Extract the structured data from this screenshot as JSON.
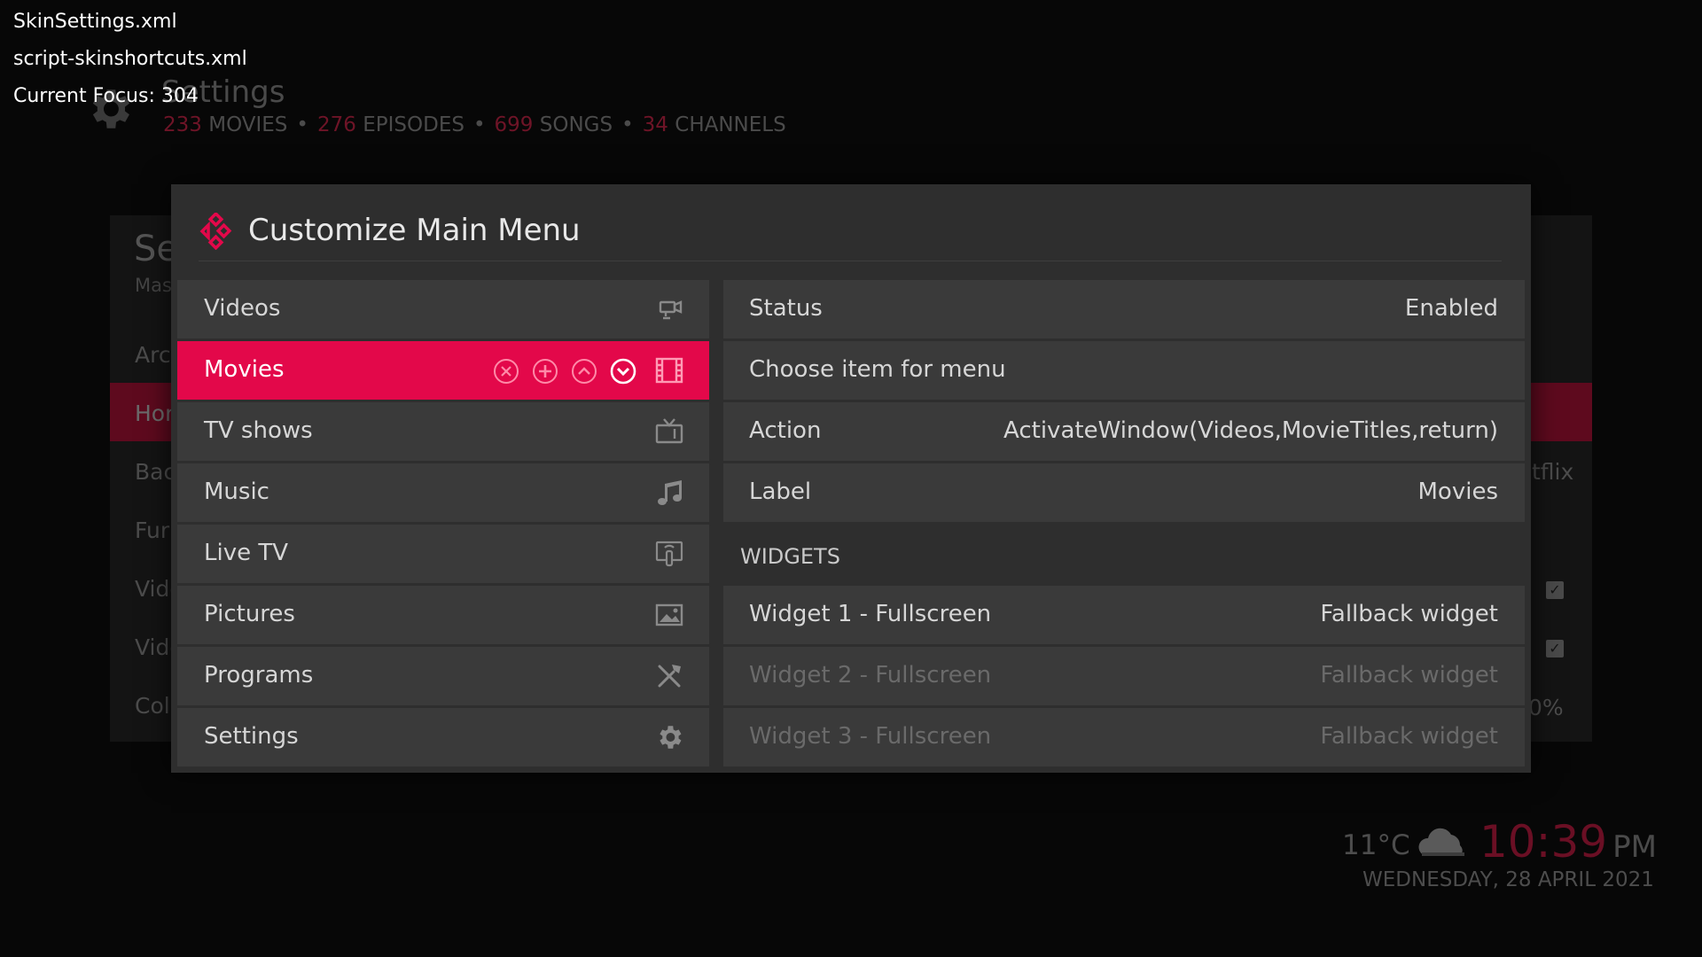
{
  "debug": {
    "line1": "SkinSettings.xml",
    "line2": "script-skinshortcuts.xml",
    "line3": "Current Focus: 304"
  },
  "background": {
    "title": "Settings",
    "stats": {
      "movies_count": "233",
      "movies_label": "MOVIES",
      "episodes_count": "276",
      "episodes_label": "EPISODES",
      "songs_count": "699",
      "songs_label": "SONGS",
      "channels_count": "34",
      "channels_label": "CHANNELS",
      "separator": "•"
    },
    "panel_heading": "Se",
    "panel_subheading": "Mas",
    "items": [
      "Arc",
      "Hor",
      "Bac",
      "Fur",
      "Vide",
      "Vide",
      "Col"
    ],
    "right_values": {
      "netflix": "tflix",
      "percent": "0%"
    },
    "check_glyph": "✓",
    "weather_temp": "11°C",
    "clock_time": "10:39",
    "clock_ampm": "PM",
    "date": "WEDNESDAY, 28 APRIL 2021"
  },
  "dialog": {
    "title": "Customize Main Menu",
    "menu_items": [
      {
        "label": "Videos",
        "icon": "video-camera-icon"
      },
      {
        "label": "Movies",
        "icon": "film-strip-icon"
      },
      {
        "label": "TV shows",
        "icon": "tv-icon"
      },
      {
        "label": "Music",
        "icon": "music-note-icon"
      },
      {
        "label": "Live TV",
        "icon": "live-tv-icon"
      },
      {
        "label": "Pictures",
        "icon": "picture-icon"
      },
      {
        "label": "Programs",
        "icon": "tools-icon"
      },
      {
        "label": "Settings",
        "icon": "gear-icon"
      }
    ],
    "focused_item_controls": [
      "delete-icon",
      "add-icon",
      "move-up-icon",
      "move-down-icon"
    ],
    "properties": [
      {
        "label": "Status",
        "value": "Enabled"
      },
      {
        "label": "Choose item for menu",
        "value": ""
      },
      {
        "label": "Action",
        "value": "ActivateWindow(Videos,MovieTitles,return)"
      },
      {
        "label": "Label",
        "value": "Movies"
      }
    ],
    "widgets_header": "WIDGETS",
    "widgets": [
      {
        "label": "Widget 1 - Fullscreen",
        "value": "Fallback widget"
      },
      {
        "label": "Widget 2 - Fullscreen",
        "value": "Fallback widget"
      },
      {
        "label": "Widget 3 - Fullscreen",
        "value": "Fallback widget"
      }
    ]
  },
  "colors": {
    "accent": "#e3084a",
    "dialog_bg": "#2e2e2e",
    "row_bg": "#3a3a3a",
    "page_bg": "#070707"
  }
}
